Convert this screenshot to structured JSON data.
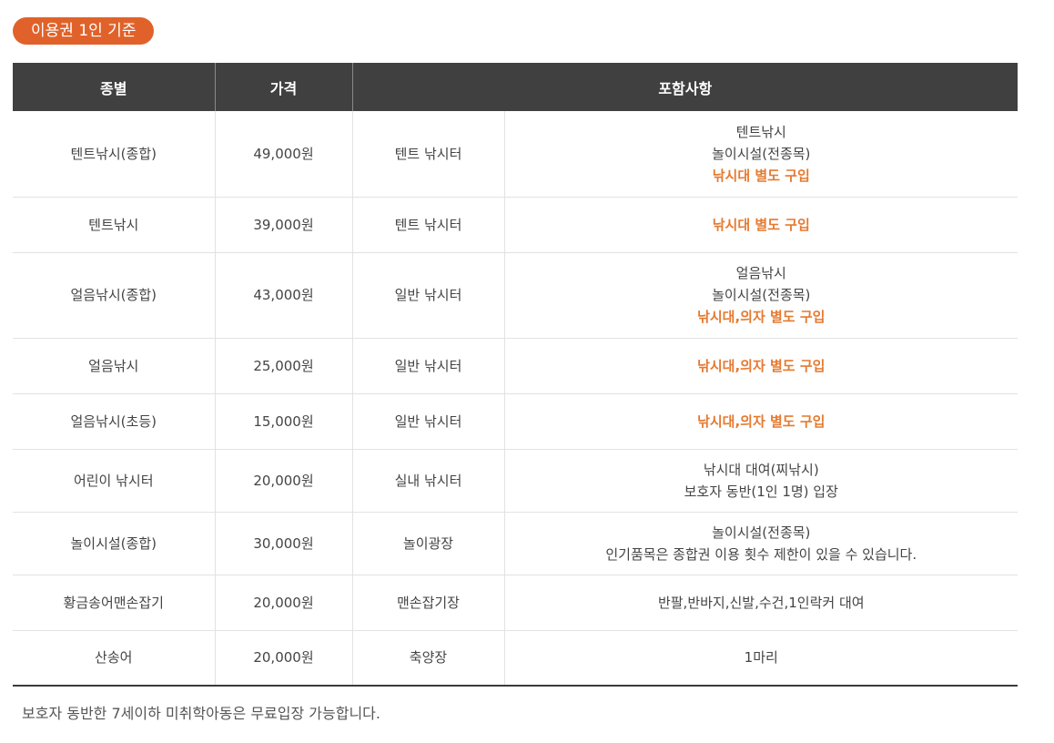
{
  "badge": "이용권 1인 기준",
  "table": {
    "headers": [
      "종별",
      "가격",
      "포함사항"
    ],
    "rows": [
      {
        "type": "텐트낚시(종합)",
        "price": "49,000원",
        "place": "텐트 낚시터",
        "lines": [
          "텐트낚시",
          "놀이시설(전종목)"
        ],
        "highlight": "낚시대 별도 구입"
      },
      {
        "type": "텐트낚시",
        "price": "39,000원",
        "place": "텐트 낚시터",
        "lines": [],
        "highlight": "낚시대 별도 구입"
      },
      {
        "type": "얼음낚시(종합)",
        "price": "43,000원",
        "place": "일반 낚시터",
        "lines": [
          "얼음낚시",
          "놀이시설(전종목)"
        ],
        "highlight": "낚시대,의자 별도 구입"
      },
      {
        "type": "얼음낚시",
        "price": "25,000원",
        "place": "일반 낚시터",
        "lines": [],
        "highlight": "낚시대,의자 별도 구입"
      },
      {
        "type": "얼음낚시(초등)",
        "price": "15,000원",
        "place": "일반 낚시터",
        "lines": [],
        "highlight": "낚시대,의자 별도 구입"
      },
      {
        "type": "어린이 낚시터",
        "price": "20,000원",
        "place": "실내 낚시터",
        "lines": [
          "낚시대 대여(찌낚시)",
          "보호자 동반(1인 1명) 입장"
        ],
        "highlight": ""
      },
      {
        "type": "놀이시설(종합)",
        "price": "30,000원",
        "place": "놀이광장",
        "lines": [
          "놀이시설(전종목)",
          "인기품목은 종합권 이용 횟수 제한이 있을 수 있습니다."
        ],
        "highlight": ""
      },
      {
        "type": "황금송어맨손잡기",
        "price": "20,000원",
        "place": "맨손잡기장",
        "lines": [
          "반팔,반바지,신발,수건,1인락커 대여"
        ],
        "highlight": ""
      },
      {
        "type": "산송어",
        "price": "20,000원",
        "place": "축양장",
        "lines": [
          "1마리"
        ],
        "highlight": ""
      }
    ]
  },
  "note": "보호자 동반한 7세이하 미취학아동은 무료입장 가능합니다.",
  "colors": {
    "accent": "#e0622a",
    "highlight": "#e57a30",
    "header_bg": "#404040"
  }
}
